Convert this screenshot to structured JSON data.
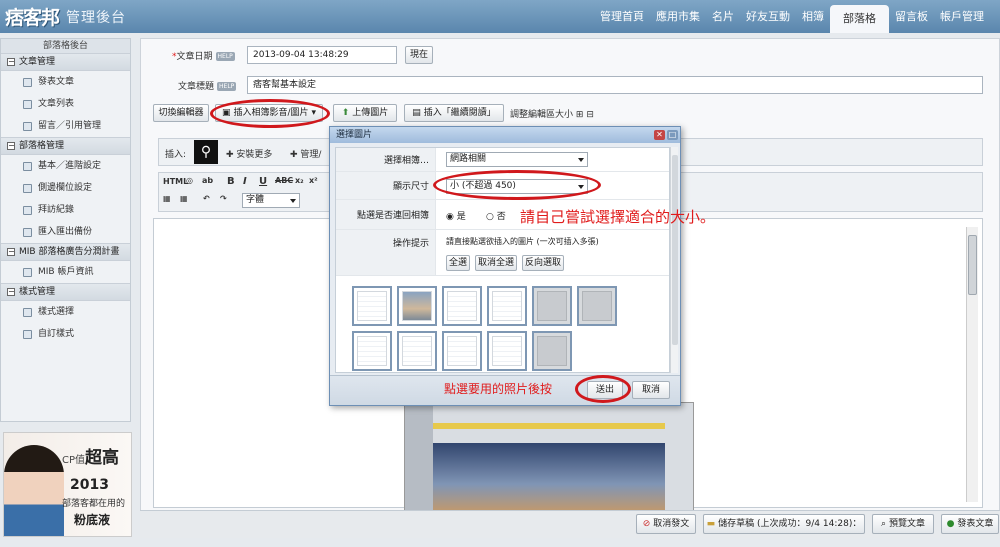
{
  "header": {
    "logo": "痞客邦",
    "admin_title": "管理後台",
    "nav": [
      "管理首頁",
      "應用市集",
      "名片",
      "好友互動",
      "相簿",
      "部落格",
      "留言板",
      "帳戶管理"
    ],
    "active_nav": "部落格"
  },
  "sidebar": {
    "title": "部落格後台",
    "sections": [
      {
        "title": "文章管理",
        "items": [
          "發表文章",
          "文章列表",
          "留言／引用管理"
        ]
      },
      {
        "title": "部落格管理",
        "items": [
          "基本／進階設定",
          "側邊欄位設定",
          "拜訪紀錄",
          "匯入匯出備份"
        ]
      },
      {
        "title": "MIB 部落格廣告分潤計畫",
        "items": [
          "MIB 帳戶資訊"
        ]
      },
      {
        "title": "樣式管理",
        "items": [
          "樣式選擇",
          "自訂樣式"
        ]
      }
    ]
  },
  "ad": {
    "line1": "CP值",
    "line1_em": "超高",
    "year": "2013",
    "line3": "部落客都在用的",
    "line4": "粉底液"
  },
  "form": {
    "date_label": "文章日期",
    "help": "HELP",
    "date_value": "2013-09-04 13:48:29",
    "now_button": "現在",
    "title_label": "文章標題",
    "title_value": "痞客幫基本設定"
  },
  "toolbar": {
    "switch_editor": "切換編輯器",
    "insert_media": "插入相簿影音/圖片",
    "upload": "上傳圖片",
    "insert_more": "插入「繼續閱讀」",
    "resize": "調整編輯區大小",
    "insert_label": "插入:",
    "install_more": "安裝更多",
    "manage": "管理/",
    "style_label": "字體"
  },
  "dialog": {
    "title": "選擇圖片",
    "album_label": "選擇相簿…",
    "album_value": "網路相關",
    "size_label": "顯示尺寸",
    "size_value": "小 (不超過 450)",
    "link_label": "點選是否連回相簿",
    "yes": "是",
    "no": "否",
    "hint_label": "操作提示",
    "hint_text": "請直接點選欲插入的圖片 (一次可插入多張)",
    "select_all": "全選",
    "deselect_all": "取消全選",
    "invert": "反向選取",
    "submit": "送出",
    "cancel": "取消"
  },
  "annotations": {
    "size_tip": "請自己嘗試選擇適合的大小。",
    "submit_tip": "點選要用的照片後按"
  },
  "bottom": {
    "cancel_post": "取消發文",
    "save_draft": "儲存草稿 (上次成功：9/4 14:28)：",
    "preview": "預覽文章",
    "publish": "發表文章"
  }
}
